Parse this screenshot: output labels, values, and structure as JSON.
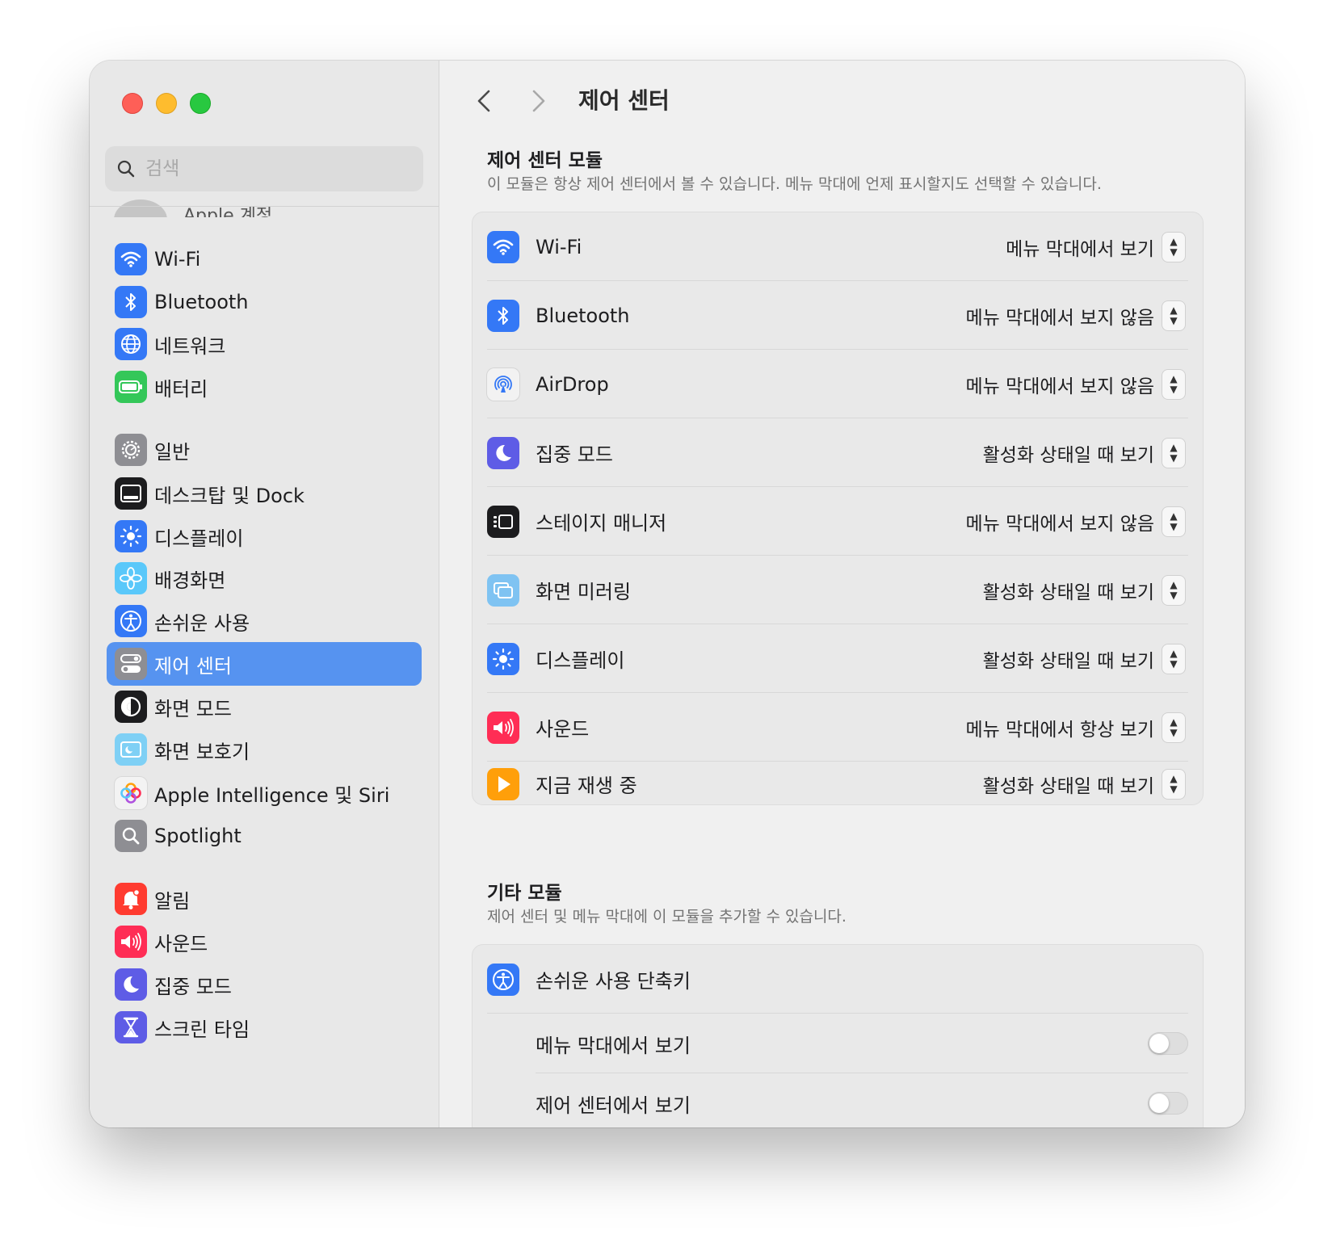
{
  "window": {
    "title": "제어 센터"
  },
  "search": {
    "placeholder": "검색"
  },
  "account": {
    "label": "Apple 계정"
  },
  "sidebar": {
    "items": [
      {
        "label": "Wi-Fi",
        "icon": "wifi-icon",
        "color": "#3478f6"
      },
      {
        "label": "Bluetooth",
        "icon": "bluetooth-icon",
        "color": "#3478f6"
      },
      {
        "label": "네트워크",
        "icon": "globe-icon",
        "color": "#3478f6"
      },
      {
        "label": "배터리",
        "icon": "battery-icon",
        "color": "#34c759"
      },
      {
        "label": "일반",
        "icon": "gear-icon",
        "color": "#8e8e93"
      },
      {
        "label": "데스크탑 및 Dock",
        "icon": "dock-icon",
        "color": "#1c1c1e"
      },
      {
        "label": "디스플레이",
        "icon": "sun-icon",
        "color": "#3478f6"
      },
      {
        "label": "배경화면",
        "icon": "flower-icon",
        "color": "#5ac8fa"
      },
      {
        "label": "손쉬운 사용",
        "icon": "accessibility-icon",
        "color": "#3478f6"
      },
      {
        "label": "제어 센터",
        "icon": "toggles-icon",
        "color": "#8e8e93",
        "selected": true
      },
      {
        "label": "화면 모드",
        "icon": "appearance-icon",
        "color": "#1c1c1e"
      },
      {
        "label": "화면 보호기",
        "icon": "screensaver-icon",
        "color": "#7fd0f5"
      },
      {
        "label": "Apple Intelligence 및 Siri",
        "icon": "siri-icon",
        "color": "#e8e8e8"
      },
      {
        "label": "Spotlight",
        "icon": "magnifier-icon",
        "color": "#8e8e93"
      },
      {
        "label": "알림",
        "icon": "bell-icon",
        "color": "#ff3b30"
      },
      {
        "label": "사운드",
        "icon": "speaker-icon",
        "color": "#ff2d55"
      },
      {
        "label": "집중 모드",
        "icon": "moon-icon",
        "color": "#5e5ce6"
      },
      {
        "label": "스크린 타임",
        "icon": "hourglass-icon",
        "color": "#5e5ce6"
      }
    ]
  },
  "main": {
    "cc_modules": {
      "title": "제어 센터 모듈",
      "subtitle": "이 모듈은 항상 제어 센터에서 볼 수 있습니다. 메뉴 막대에 언제 표시할지도 선택할 수 있습니다.",
      "rows": [
        {
          "label": "Wi-Fi",
          "value": "메뉴 막대에서 보기",
          "icon": "wifi-icon",
          "color": "#3478f6"
        },
        {
          "label": "Bluetooth",
          "value": "메뉴 막대에서 보지 않음",
          "icon": "bluetooth-icon",
          "color": "#3478f6"
        },
        {
          "label": "AirDrop",
          "value": "메뉴 막대에서 보지 않음",
          "icon": "airdrop-icon",
          "color": "#f2f2f2"
        },
        {
          "label": "집중 모드",
          "value": "활성화 상태일 때 보기",
          "icon": "moon-icon",
          "color": "#5e5ce6"
        },
        {
          "label": "스테이지 매니저",
          "value": "메뉴 막대에서 보지 않음",
          "icon": "stage-manager-icon",
          "color": "#1c1c1e"
        },
        {
          "label": "화면 미러링",
          "value": "활성화 상태일 때 보기",
          "icon": "mirroring-icon",
          "color": "#7fc3f2"
        },
        {
          "label": "디스플레이",
          "value": "활성화 상태일 때 보기",
          "icon": "sun-icon",
          "color": "#3478f6"
        },
        {
          "label": "사운드",
          "value": "메뉴 막대에서 항상 보기",
          "icon": "speaker-icon",
          "color": "#ff2d55"
        },
        {
          "label": "지금 재생 중",
          "value": "활성화 상태일 때 보기",
          "icon": "play-icon",
          "color": "#ff9f0a"
        }
      ]
    },
    "other_modules": {
      "title": "기타 모듈",
      "subtitle": "제어 센터 및 메뉴 막대에 이 모듈을 추가할 수 있습니다.",
      "items": [
        {
          "label": "손쉬운 사용 단축키",
          "icon": "accessibility-icon",
          "color": "#3478f6",
          "options": [
            {
              "label": "메뉴 막대에서 보기",
              "on": false
            },
            {
              "label": "제어 센터에서 보기",
              "on": false
            }
          ]
        }
      ]
    }
  }
}
